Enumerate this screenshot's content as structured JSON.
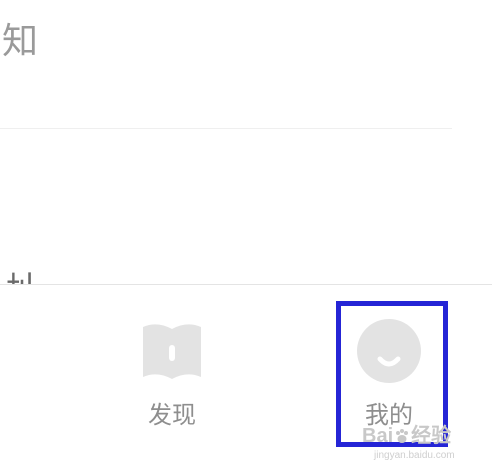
{
  "header": {
    "title_fragment": "知",
    "partial_line_text": "址"
  },
  "tabbar": {
    "tabs": [
      {
        "id": "discover",
        "label": "发现",
        "icon": "book-icon"
      },
      {
        "id": "mine",
        "label": "我的",
        "icon": "avatar-icon",
        "highlighted": true
      }
    ]
  },
  "watermark": {
    "text_left": "Bai",
    "text_right": "经验",
    "url": "jingyan.baidu.com"
  },
  "colors": {
    "icon_gray": "#e3e3e3",
    "label_gray": "#8e8e8e",
    "highlight_blue": "#2525d6"
  }
}
